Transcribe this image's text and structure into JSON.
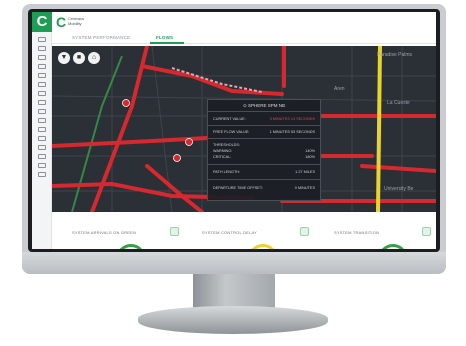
{
  "app": {
    "logo_letter": "C",
    "brand_line1": "Centracs",
    "brand_line2": "Mobility"
  },
  "tabs": [
    {
      "label": "SYSTEM PERFORMANCE",
      "active": false
    },
    {
      "label": "FLOWS",
      "active": true
    }
  ],
  "map": {
    "places": [
      "Paradise Palms",
      "Aren",
      "La Cueste",
      "University Be"
    ],
    "buttons": [
      "filter-icon",
      "layers-icon",
      "home-icon"
    ]
  },
  "popup": {
    "title": "SPHERE SPM NB",
    "current_label": "CURRENT VALUE:",
    "current_value": "3 MINUTES 13 SECONDS",
    "free_flow_label": "FREE FLOW VALUE:",
    "free_flow_value": "1 MINUTES 53 SECONDS",
    "thresholds_label": "THRESHOLDS:",
    "warning_label": "WARNING:",
    "warning_value": "140%",
    "critical_label": "CRITICAL:",
    "critical_value": "180%",
    "path_label": "PATH LENGTH:",
    "path_value": "1.27 MILES",
    "departure_label": "DEPARTURE TIME OFFSET:",
    "departure_value": "0 MINUTES"
  },
  "stats": [
    {
      "label": "SYSTEM ARRIVALS ON GREEN"
    },
    {
      "label": "SYSTEM CONTROL DELAY"
    },
    {
      "label": "SYSTEM TRANSITION"
    }
  ],
  "colors": {
    "brand": "#1f9d55",
    "congested": "#d6282f",
    "warning": "#e8d42a",
    "free": "#3a9e4a",
    "map_bg": "#2b2f36"
  }
}
